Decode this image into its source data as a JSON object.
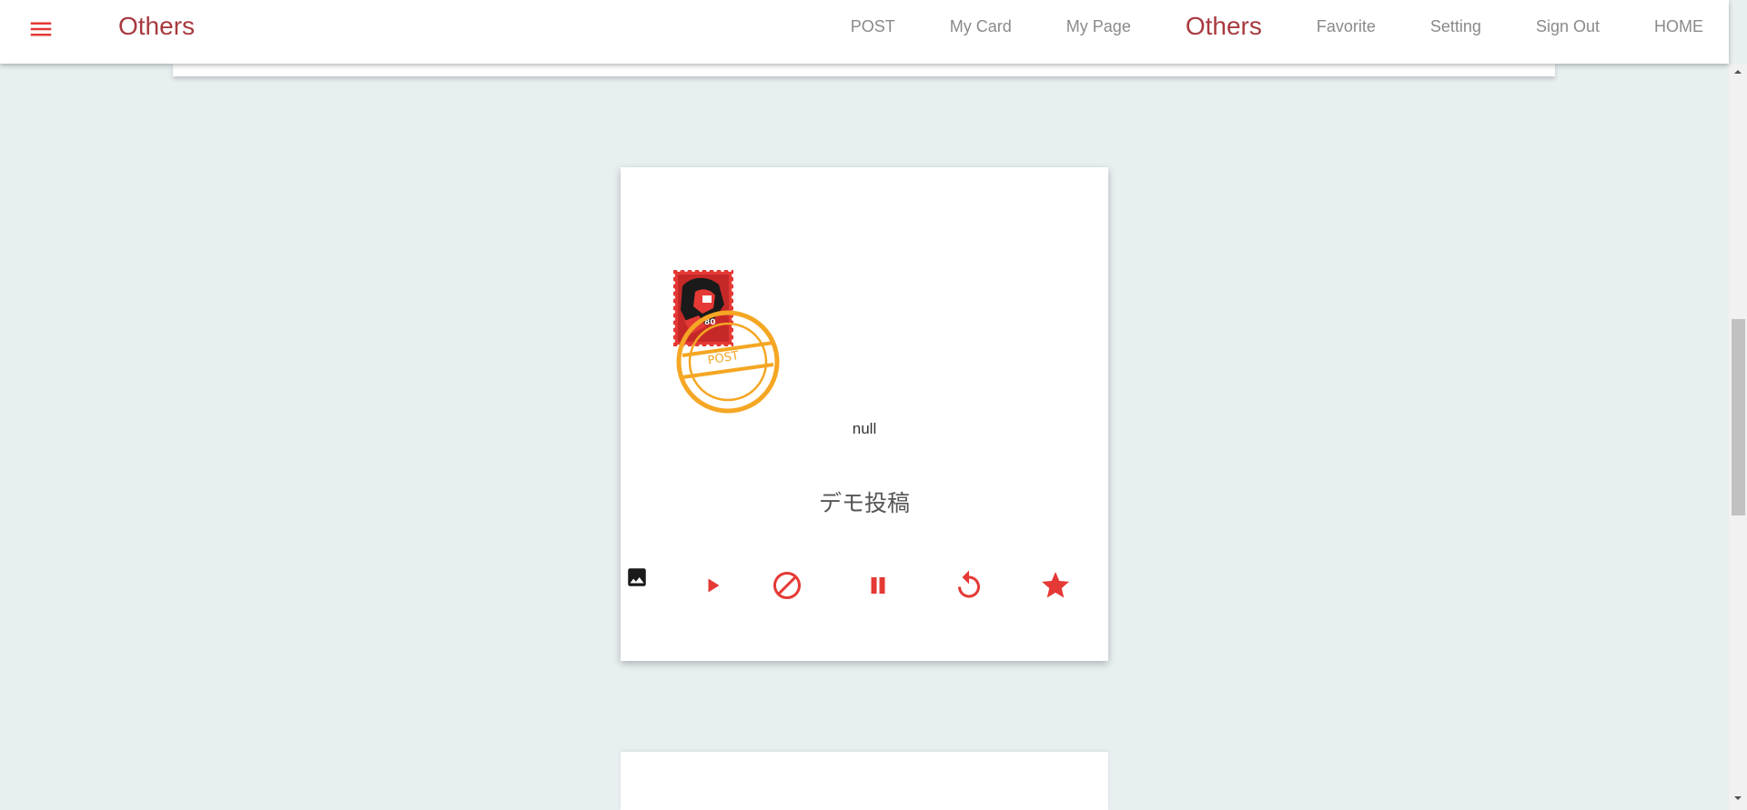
{
  "appbar": {
    "brand": "Others",
    "nav": [
      {
        "label": "POST"
      },
      {
        "label": "My Card"
      },
      {
        "label": "My Page"
      },
      {
        "label": "Others"
      },
      {
        "label": "Favorite"
      },
      {
        "label": "Setting"
      },
      {
        "label": "Sign Out"
      },
      {
        "label": "HOME"
      }
    ],
    "active_item": "Others"
  },
  "card": {
    "stamp_text": "POST",
    "caption": "null",
    "title": "デモ投稿",
    "actions": [
      {
        "name": "play",
        "icon": "play-icon"
      },
      {
        "name": "block",
        "icon": "block-icon"
      },
      {
        "name": "pause",
        "icon": "pause-icon"
      },
      {
        "name": "replay",
        "icon": "replay-icon"
      },
      {
        "name": "favorite",
        "icon": "star-icon"
      }
    ],
    "image_icon": "image-icon"
  },
  "colors": {
    "accent": "#a83a3f",
    "action_red": "#e53935",
    "stamp_orange": "#f5a623",
    "nav_text": "#8a8a8a",
    "background": "#e8eff1"
  }
}
